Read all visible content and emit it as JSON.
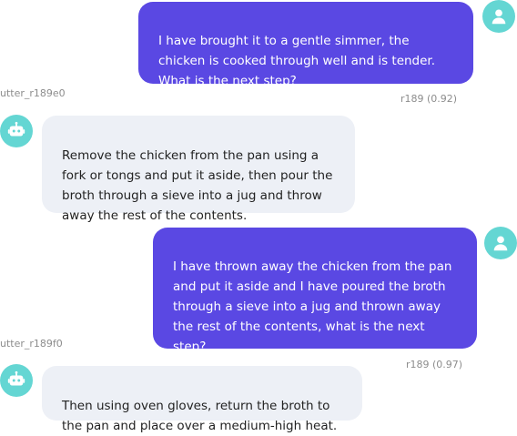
{
  "colors": {
    "user_bubble": "#5a48e3",
    "bot_bubble": "#edf0f6",
    "avatar": "#64d6d3"
  },
  "messages": [
    {
      "sender": "user",
      "text": "I have brought it to a gentle simmer, the\nchicken is cooked through well and is tender.\nWhat is the next step?",
      "intent": "r189 (0.92)"
    },
    {
      "sender": "bot",
      "label": "utter_r189e0",
      "text": "Remove the chicken from the pan using a\nfork or tongs and put it aside, then pour the\nbroth through a sieve into a jug and throw\naway the rest of the contents."
    },
    {
      "sender": "user",
      "text": "I have thrown away the chicken from the pan\nand put it aside and I have poured the broth\nthrough a sieve into a jug and thrown away\nthe rest of the contents, what is the next\nstep?",
      "intent": "r189 (0.97)"
    },
    {
      "sender": "bot",
      "label": "utter_r189f0",
      "text": "Then using oven gloves, return the broth to\nthe pan and place over a medium-high heat."
    }
  ],
  "icons": {
    "user_avatar": "user-icon",
    "bot_avatar": "robot-icon"
  }
}
